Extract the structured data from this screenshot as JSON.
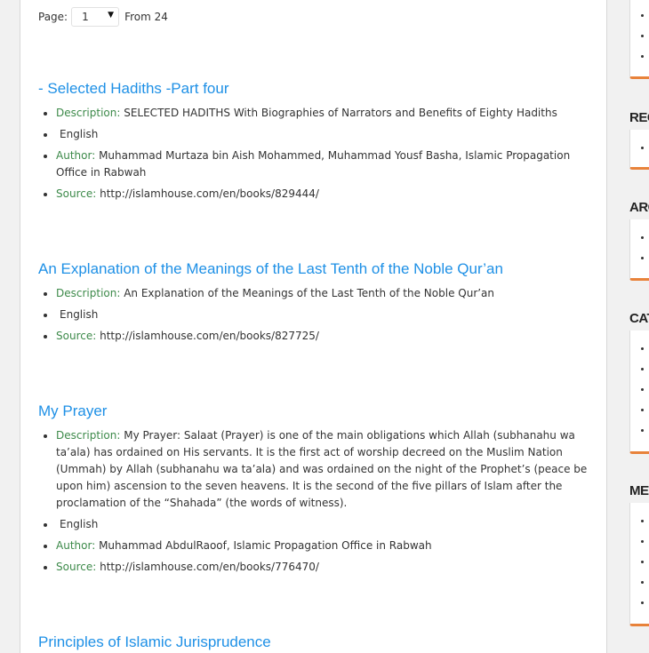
{
  "pager": {
    "label": "Page:",
    "current": "1",
    "from_text": "From 24"
  },
  "books": [
    {
      "title": "- Selected Hadiths -Part four",
      "description_label": "Description:",
      "description": "SELECTED HADITHS With Biographies of Narrators and Benefits of Eighty Hadiths",
      "language": "English",
      "author_label": "Author:",
      "author": "Muhammad Murtaza bin Aish Mohammed, Muhammad Yousf Basha, Islamic Propagation Office in Rabwah",
      "source_label": "Source:",
      "source": "http://islamhouse.com/en/books/829444/"
    },
    {
      "title": "An Explanation of the Meanings of the Last Tenth of the Noble Qur’an",
      "description_label": "Description:",
      "description": "An Explanation of the Meanings of the Last Tenth of the Noble Qur’an",
      "language": "English",
      "source_label": "Source:",
      "source": "http://islamhouse.com/en/books/827725/"
    },
    {
      "title": "My Prayer",
      "description_label": "Description:",
      "description": "My Prayer: Salaat (Prayer) is one of the main obligations which Allah (subhanahu wa ta’ala) has ordained on His servants. It is the first act of worship decreed on the Muslim Nation (Ummah) by Allah (subhanahu wa ta’ala) and was ordained on the night of the Prophet’s (peace be upon him) ascension to the seven heavens. It is the second of the five pillars of Islam after the proclamation of the “Shahada” (the words of witness).",
      "language": "English",
      "author_label": "Author:",
      "author": "Muhammad AbdulRaoof, Islamic Propagation Office in Rabwah",
      "source_label": "Source:",
      "source": "http://islamhouse.com/en/books/776470/"
    },
    {
      "title": "Principles of Islamic Jurisprudence"
    }
  ],
  "sidebar": {
    "titles": [
      "REC",
      "ARC",
      "CAT",
      "MET"
    ]
  },
  "colors": {
    "link": "#1e90e6",
    "label": "#3d8a4a",
    "accent": "#e8823a"
  }
}
